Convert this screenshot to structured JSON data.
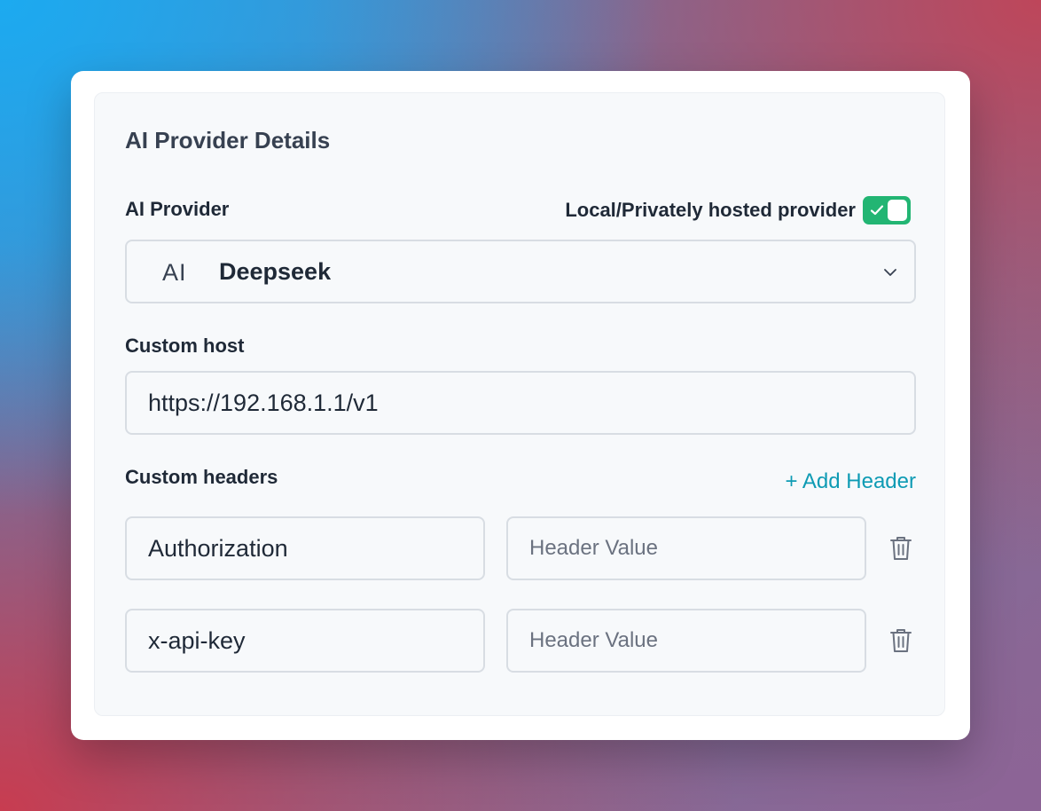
{
  "panel": {
    "title": "AI Provider Details"
  },
  "provider": {
    "label": "AI Provider",
    "toggle_label": "Local/Privately hosted provider",
    "toggle_on": true,
    "badge": "AI",
    "selected": "Deepseek",
    "icon": "chevron-down-icon"
  },
  "host": {
    "label": "Custom host",
    "value": "https://192.168.1.1/v1"
  },
  "headers": {
    "label": "Custom headers",
    "add_label": "+ Add Header",
    "rows": [
      {
        "key": "Authorization",
        "value_placeholder": "Header Value"
      },
      {
        "key": "x-api-key",
        "value_placeholder": "Header Value"
      }
    ],
    "delete_icon": "trash-icon"
  },
  "colors": {
    "accent": "#0e9bb4",
    "toggle": "#22b573",
    "text": "#1f2937"
  }
}
